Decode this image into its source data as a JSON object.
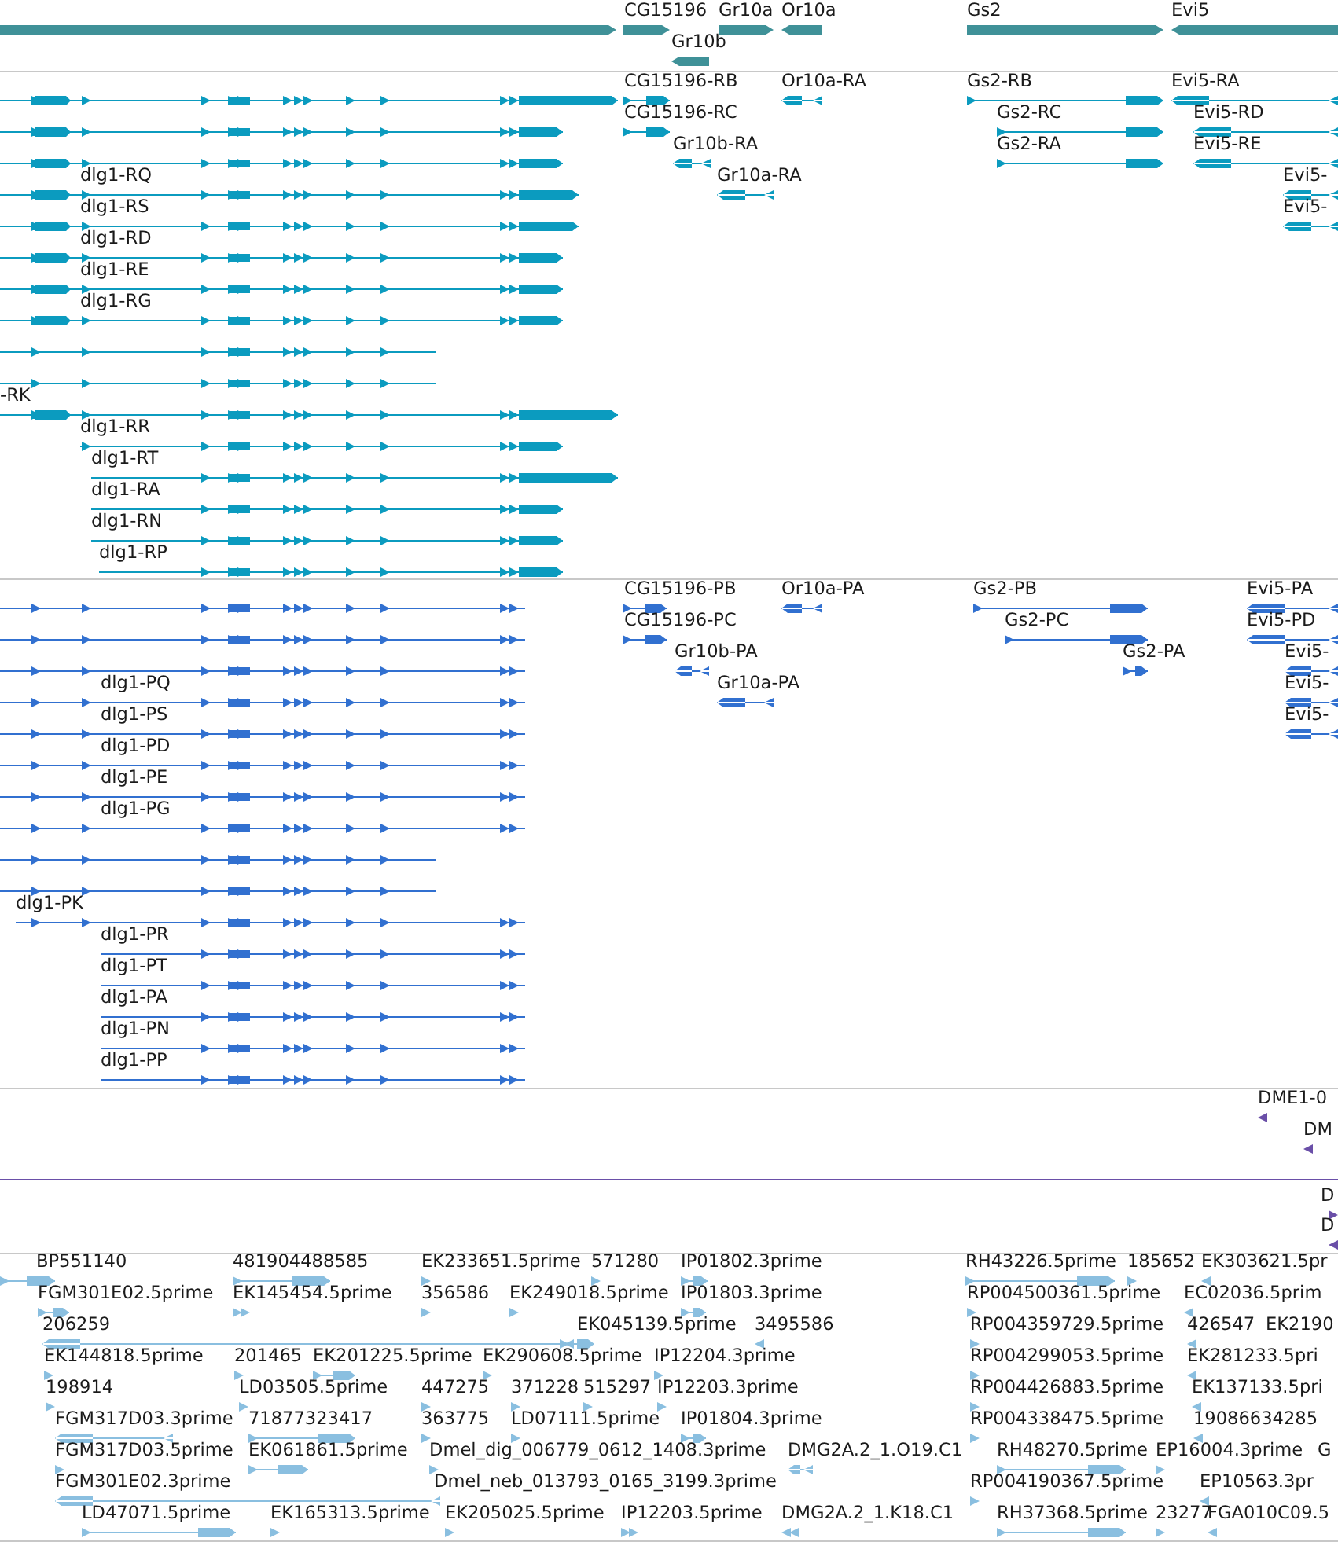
{
  "tracks": [
    {
      "kind": "gene",
      "features": [
        {
          "label": "CG15196"
        },
        {
          "label": "Gr10a"
        },
        {
          "label": "Or10a"
        },
        {
          "label": "Gs2"
        },
        {
          "label": "Evi5"
        },
        {
          "label": "Gr10b"
        }
      ]
    },
    {
      "kind": "transcript",
      "features": [
        {
          "label": "CG15196-RB"
        },
        {
          "label": "Or10a-RA"
        },
        {
          "label": "Gs2-RB"
        },
        {
          "label": "Evi5-RA"
        },
        {
          "label": "CG15196-RC"
        },
        {
          "label": "Gs2-RC"
        },
        {
          "label": "Evi5-RD"
        },
        {
          "label": "Gr10b-RA"
        },
        {
          "label": "Gs2-RA"
        },
        {
          "label": "Evi5-RE"
        },
        {
          "label": "dlg1-RQ"
        },
        {
          "label": "Gr10a-RA"
        },
        {
          "label": "Evi5-"
        },
        {
          "label": "dlg1-RS"
        },
        {
          "label": "Evi5-"
        },
        {
          "label": "dlg1-RD"
        },
        {
          "label": "dlg1-RE"
        },
        {
          "label": "dlg1-RG"
        },
        {
          "label": "-RK"
        },
        {
          "label": "dlg1-RR"
        },
        {
          "label": "dlg1-RT"
        },
        {
          "label": "dlg1-RA"
        },
        {
          "label": "dlg1-RN"
        },
        {
          "label": "dlg1-RP"
        }
      ]
    },
    {
      "kind": "cds",
      "features": [
        {
          "label": "CG15196-PB"
        },
        {
          "label": "Or10a-PA"
        },
        {
          "label": "Gs2-PB"
        },
        {
          "label": "Evi5-PA"
        },
        {
          "label": "CG15196-PC"
        },
        {
          "label": "Gs2-PC"
        },
        {
          "label": "Evi5-PD"
        },
        {
          "label": "Gr10b-PA"
        },
        {
          "label": "Gs2-PA"
        },
        {
          "label": "Evi5-"
        },
        {
          "label": "dlg1-PQ"
        },
        {
          "label": "Gr10a-PA"
        },
        {
          "label": "Evi5-"
        },
        {
          "label": "dlg1-PS"
        },
        {
          "label": "Evi5-"
        },
        {
          "label": "dlg1-PD"
        },
        {
          "label": "dlg1-PE"
        },
        {
          "label": "dlg1-PG"
        },
        {
          "label": "dlg1-PK"
        },
        {
          "label": "dlg1-PR"
        },
        {
          "label": "dlg1-PT"
        },
        {
          "label": "dlg1-PA"
        },
        {
          "label": "dlg1-PN"
        },
        {
          "label": "dlg1-PP"
        }
      ]
    },
    {
      "kind": "match",
      "features": [
        {
          "label": "DME1-0"
        },
        {
          "label": "DM"
        },
        {
          "label": "D"
        },
        {
          "label": "D"
        }
      ]
    },
    {
      "kind": "est",
      "features": [
        {
          "label": "BP551140"
        },
        {
          "label": "481904488585"
        },
        {
          "label": "EK233651.5prime"
        },
        {
          "label": "571280"
        },
        {
          "label": "IP01802.3prime"
        },
        {
          "label": "RH43226.5prime"
        },
        {
          "label": "185652"
        },
        {
          "label": "EK303621.5pr"
        },
        {
          "label": "FGM301E02.5prime"
        },
        {
          "label": "EK145454.5prime"
        },
        {
          "label": "356586"
        },
        {
          "label": "EK249018.5prime"
        },
        {
          "label": "IP01803.3prime"
        },
        {
          "label": "RP004500361.5prime"
        },
        {
          "label": "EC02036.5prim"
        },
        {
          "label": "206259"
        },
        {
          "label": "EK045139.5prime"
        },
        {
          "label": "3495586"
        },
        {
          "label": "RP004359729.5prime"
        },
        {
          "label": "426547"
        },
        {
          "label": "EK2190"
        },
        {
          "label": "EK144818.5prime"
        },
        {
          "label": "201465"
        },
        {
          "label": "EK201225.5prime"
        },
        {
          "label": "EK290608.5prime"
        },
        {
          "label": "IP12204.3prime"
        },
        {
          "label": "RP004299053.5prime"
        },
        {
          "label": "EK281233.5pri"
        },
        {
          "label": "198914"
        },
        {
          "label": "LD03505.5prime"
        },
        {
          "label": "447275"
        },
        {
          "label": "371228"
        },
        {
          "label": "515297"
        },
        {
          "label": "IP12203.3prime"
        },
        {
          "label": "RP004426883.5prime"
        },
        {
          "label": "EK137133.5pri"
        },
        {
          "label": "FGM317D03.3prime"
        },
        {
          "label": "71877323417"
        },
        {
          "label": "363775"
        },
        {
          "label": "LD07111.5prime"
        },
        {
          "label": "IP01804.3prime"
        },
        {
          "label": "RP004338475.5prime"
        },
        {
          "label": "19086634285"
        },
        {
          "label": "FGM317D03.5prime"
        },
        {
          "label": "EK061861.5prime"
        },
        {
          "label": "Dmel_dig_006779_0612_1408.3prime"
        },
        {
          "label": "DMG2A.2_1.O19.C1"
        },
        {
          "label": "RH48270.5prime"
        },
        {
          "label": "EP16004.3prime"
        },
        {
          "label": "G"
        },
        {
          "label": "FGM301E02.3prime"
        },
        {
          "label": "Dmel_neb_013793_0165_3199.3prime"
        },
        {
          "label": "RP004190367.5prime"
        },
        {
          "label": "EP10563.3pr"
        },
        {
          "label": "LD47071.5prime"
        },
        {
          "label": "EK165313.5prime"
        },
        {
          "label": "EK205025.5prime"
        },
        {
          "label": "IP12203.5prime"
        },
        {
          "label": "DMG2A.2_1.K18.C1"
        },
        {
          "label": "RH37368.5prime"
        },
        {
          "label": "23277"
        },
        {
          "label": "FGA010C09.5"
        }
      ]
    }
  ]
}
